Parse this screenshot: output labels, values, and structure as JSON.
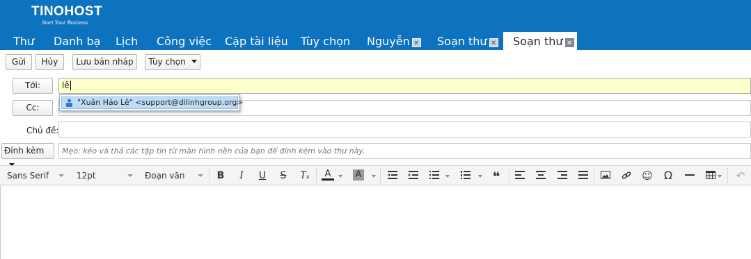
{
  "logo": {
    "name": "TINOHOST",
    "tagline": "Start Your Business"
  },
  "tabs": [
    {
      "label": "Thư"
    },
    {
      "label": "Danh bạ"
    },
    {
      "label": "Lịch"
    },
    {
      "label": "Công việc"
    },
    {
      "label": "Cặp tài liệu"
    },
    {
      "label": "Tùy chọn"
    },
    {
      "label": "Nguyễn",
      "closable": true
    },
    {
      "label": "Soạn thư",
      "closable": true
    },
    {
      "label": "Soạn thư",
      "closable": true,
      "active": true
    }
  ],
  "toolbar": {
    "send": "Gửi",
    "cancel": "Hủy",
    "save_draft": "Lưu bản nháp",
    "options": "Tùy chọn"
  },
  "compose": {
    "to_label": "Tới:",
    "to_value": "lê",
    "cc_label": "Cc:",
    "subject_label": "Chủ đề:",
    "attach_label": "Đính kèm",
    "attach_hint": "Mẹo: kéo và thả các tập tin từ màn hình nền của bạn để đính kèm vào thư này."
  },
  "autocomplete": {
    "suggestion": "\"Xuân Hảo Lê\" <support@dilinhgroup.org>"
  },
  "editor_toolbar": {
    "font_family": "Sans Serif",
    "font_size": "12pt",
    "paragraph": "Đoạn văn",
    "icons": [
      "bold-icon",
      "italic-icon",
      "underline-icon",
      "strikethrough-icon",
      "clear-format-icon",
      "text-color-icon",
      "highlight-color-icon",
      "outdent-icon",
      "indent-icon",
      "bullet-list-icon",
      "numbered-list-icon",
      "blockquote-icon",
      "align-left-icon",
      "align-center-icon",
      "align-right-icon",
      "justify-icon",
      "image-icon",
      "link-icon",
      "emoticon-icon",
      "special-char-icon",
      "horizontal-rule-icon",
      "table-icon",
      "undo-icon"
    ]
  },
  "colors": {
    "header": "#0d73bf",
    "focus_field": "#ffffcc",
    "suggestion_highlight": "#bfdcf7"
  }
}
